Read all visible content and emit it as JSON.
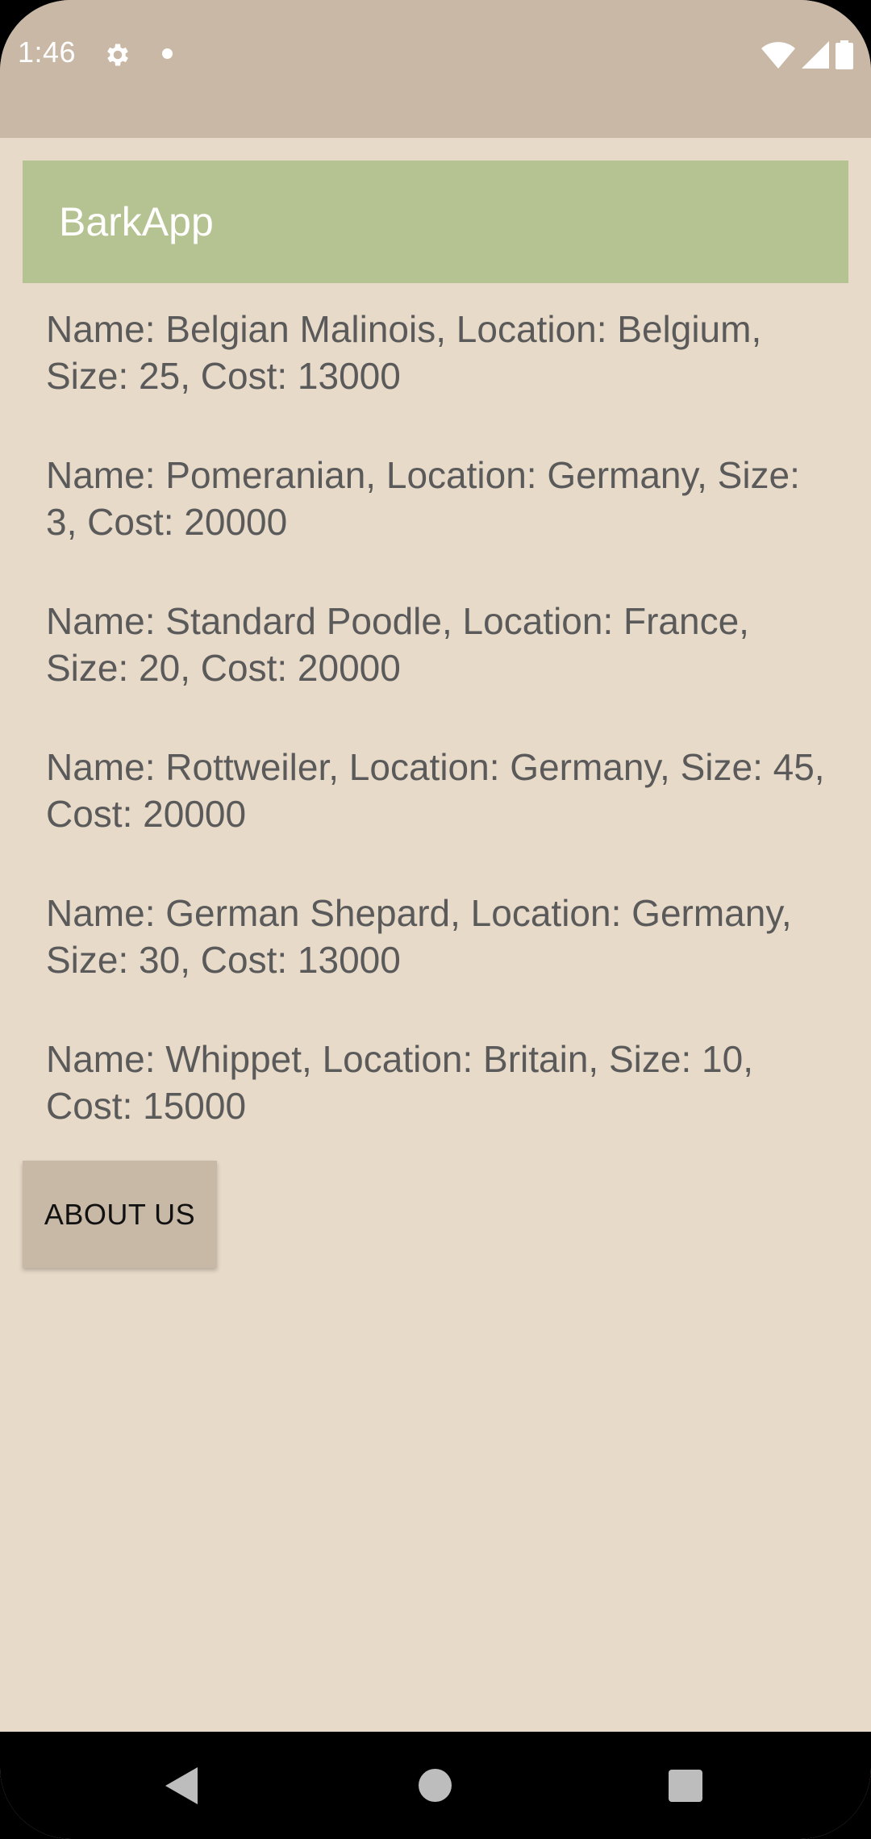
{
  "status_bar": {
    "time": "1:46",
    "icons": [
      "gear-icon",
      "dot-icon",
      "wifi-icon",
      "signal-icon",
      "battery-icon"
    ]
  },
  "app_bar": {
    "title": "BarkApp"
  },
  "dogs": [
    {
      "text": "Name: Belgian Malinois, Location: Belgium, Size: 25, Cost: 13000"
    },
    {
      "text": "Name: Pomeranian, Location: Germany, Size: 3, Cost: 20000"
    },
    {
      "text": "Name: Standard Poodle, Location: France, Size: 20, Cost: 20000"
    },
    {
      "text": "Name: Rottweiler, Location: Germany, Size: 45, Cost: 20000"
    },
    {
      "text": "Name: German Shepard, Location: Germany, Size: 30, Cost: 13000"
    },
    {
      "text": "Name: Whippet, Location: Britain, Size: 10, Cost: 15000"
    }
  ],
  "about_button": {
    "label": "ABOUT US"
  },
  "nav_bar": {
    "icons": [
      "back-icon",
      "home-icon",
      "recents-icon"
    ]
  },
  "colors": {
    "status_bar": "#c9b8a6",
    "background": "#e8dac9",
    "app_bar": "#b5c291",
    "button": "#c8b8a6",
    "text": "#5a5a5a"
  }
}
